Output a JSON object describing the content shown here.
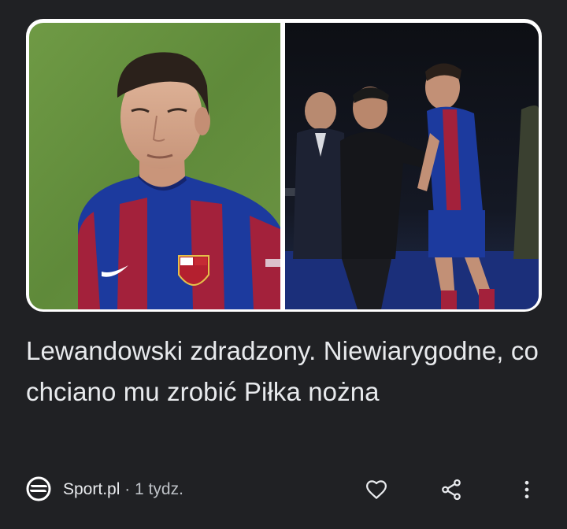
{
  "article": {
    "headline": "Lewandowski zdradzony. Niewiarygodne, co chciano mu zrobić Piłka nożna",
    "source_name": "Sport.pl",
    "separator": " · ",
    "age": "1 tydz."
  },
  "icons": {
    "source_logo": "sport-pl-logo-icon",
    "like": "heart-outline-icon",
    "share": "share-icon",
    "more": "more-vertical-icon"
  },
  "colors": {
    "background": "#202124",
    "text": "#e8eaed",
    "secondary_text": "#bdc1c6"
  }
}
